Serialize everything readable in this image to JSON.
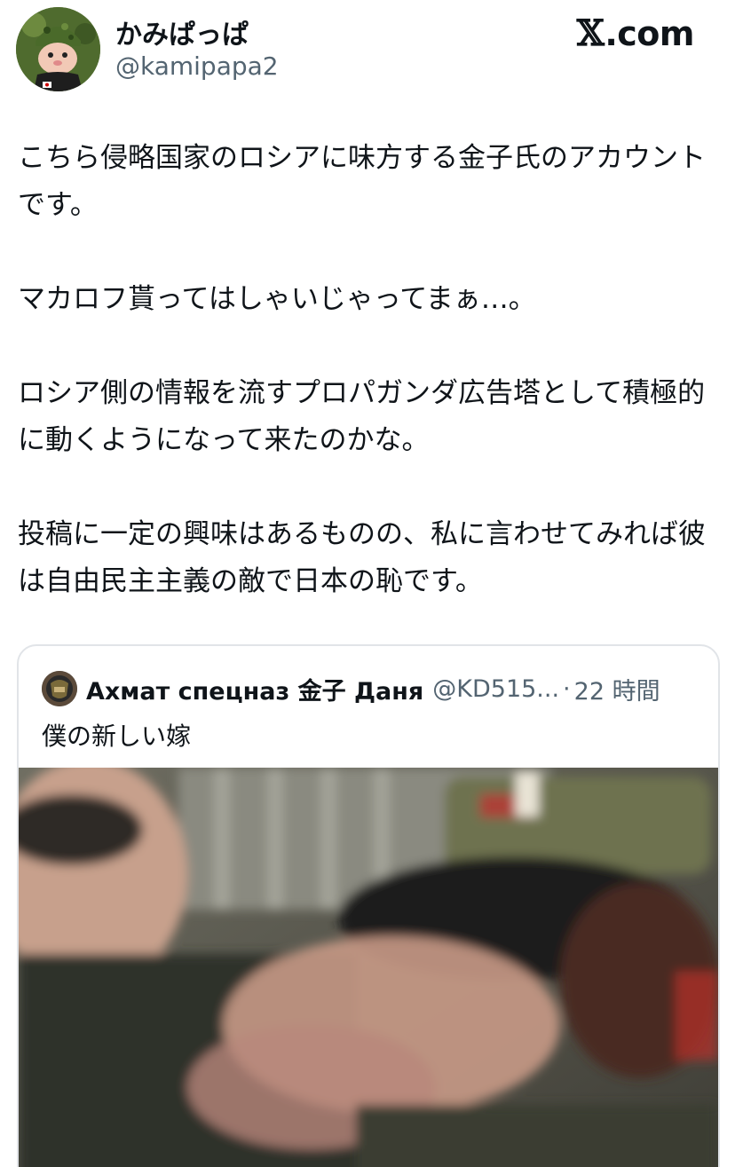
{
  "header": {
    "display_name": "かみぱっぱ",
    "handle": "@kamipapa2",
    "brand_mark": "𝕏",
    "brand_text": ".com"
  },
  "tweet": {
    "paragraphs": [
      "こちら侵略国家のロシアに味方する金子氏のアカウントです。",
      "マカロフ貰ってはしゃいじゃってまぁ…。",
      "ロシア側の情報を流すプロパガンダ広告塔として積極的に動くようになって来たのかな。",
      "投稿に一定の興味はあるものの、私に言わせてみれば彼は自由民主主義の敵で日本の恥です。"
    ]
  },
  "quote": {
    "author_name": "Ахмат спецназ 金子 Даня",
    "author_handle": "@KD515...",
    "separator": "·",
    "time": "22 時間",
    "text": "僕の新しい嫁"
  },
  "icons": {
    "avatar": "cartoon-helmet-avatar",
    "quote_avatar": "patch-emblem-avatar",
    "media": "video-still-image"
  }
}
